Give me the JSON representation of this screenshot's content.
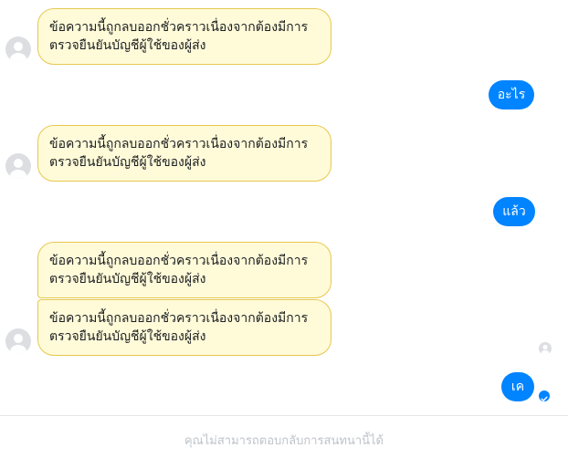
{
  "messages": {
    "deleted_text_line1": "ข้อความนี้ถูกลบออกชั่วคราวเนื่องจากต้องมีการ",
    "deleted_text_line2": "ตรวจยืนยันบัญชีผู้ใช้ของผู้ส่ง",
    "reply1": "อะไร",
    "reply2": "แล้ว",
    "reply3": "เค"
  },
  "footer": {
    "notice": "คุณไม่สามารถตอบกลับการสนทนานี้ได้"
  },
  "colors": {
    "outgoing_bubble": "#0084ff",
    "deleted_bubble_bg": "#fffbd9",
    "deleted_bubble_border": "#e6c84f"
  },
  "icons": {
    "sender_avatar": "default-user-avatar-icon",
    "read_receipt": "read-receipt-avatar-icon",
    "delivered": "delivered-check-icon"
  }
}
